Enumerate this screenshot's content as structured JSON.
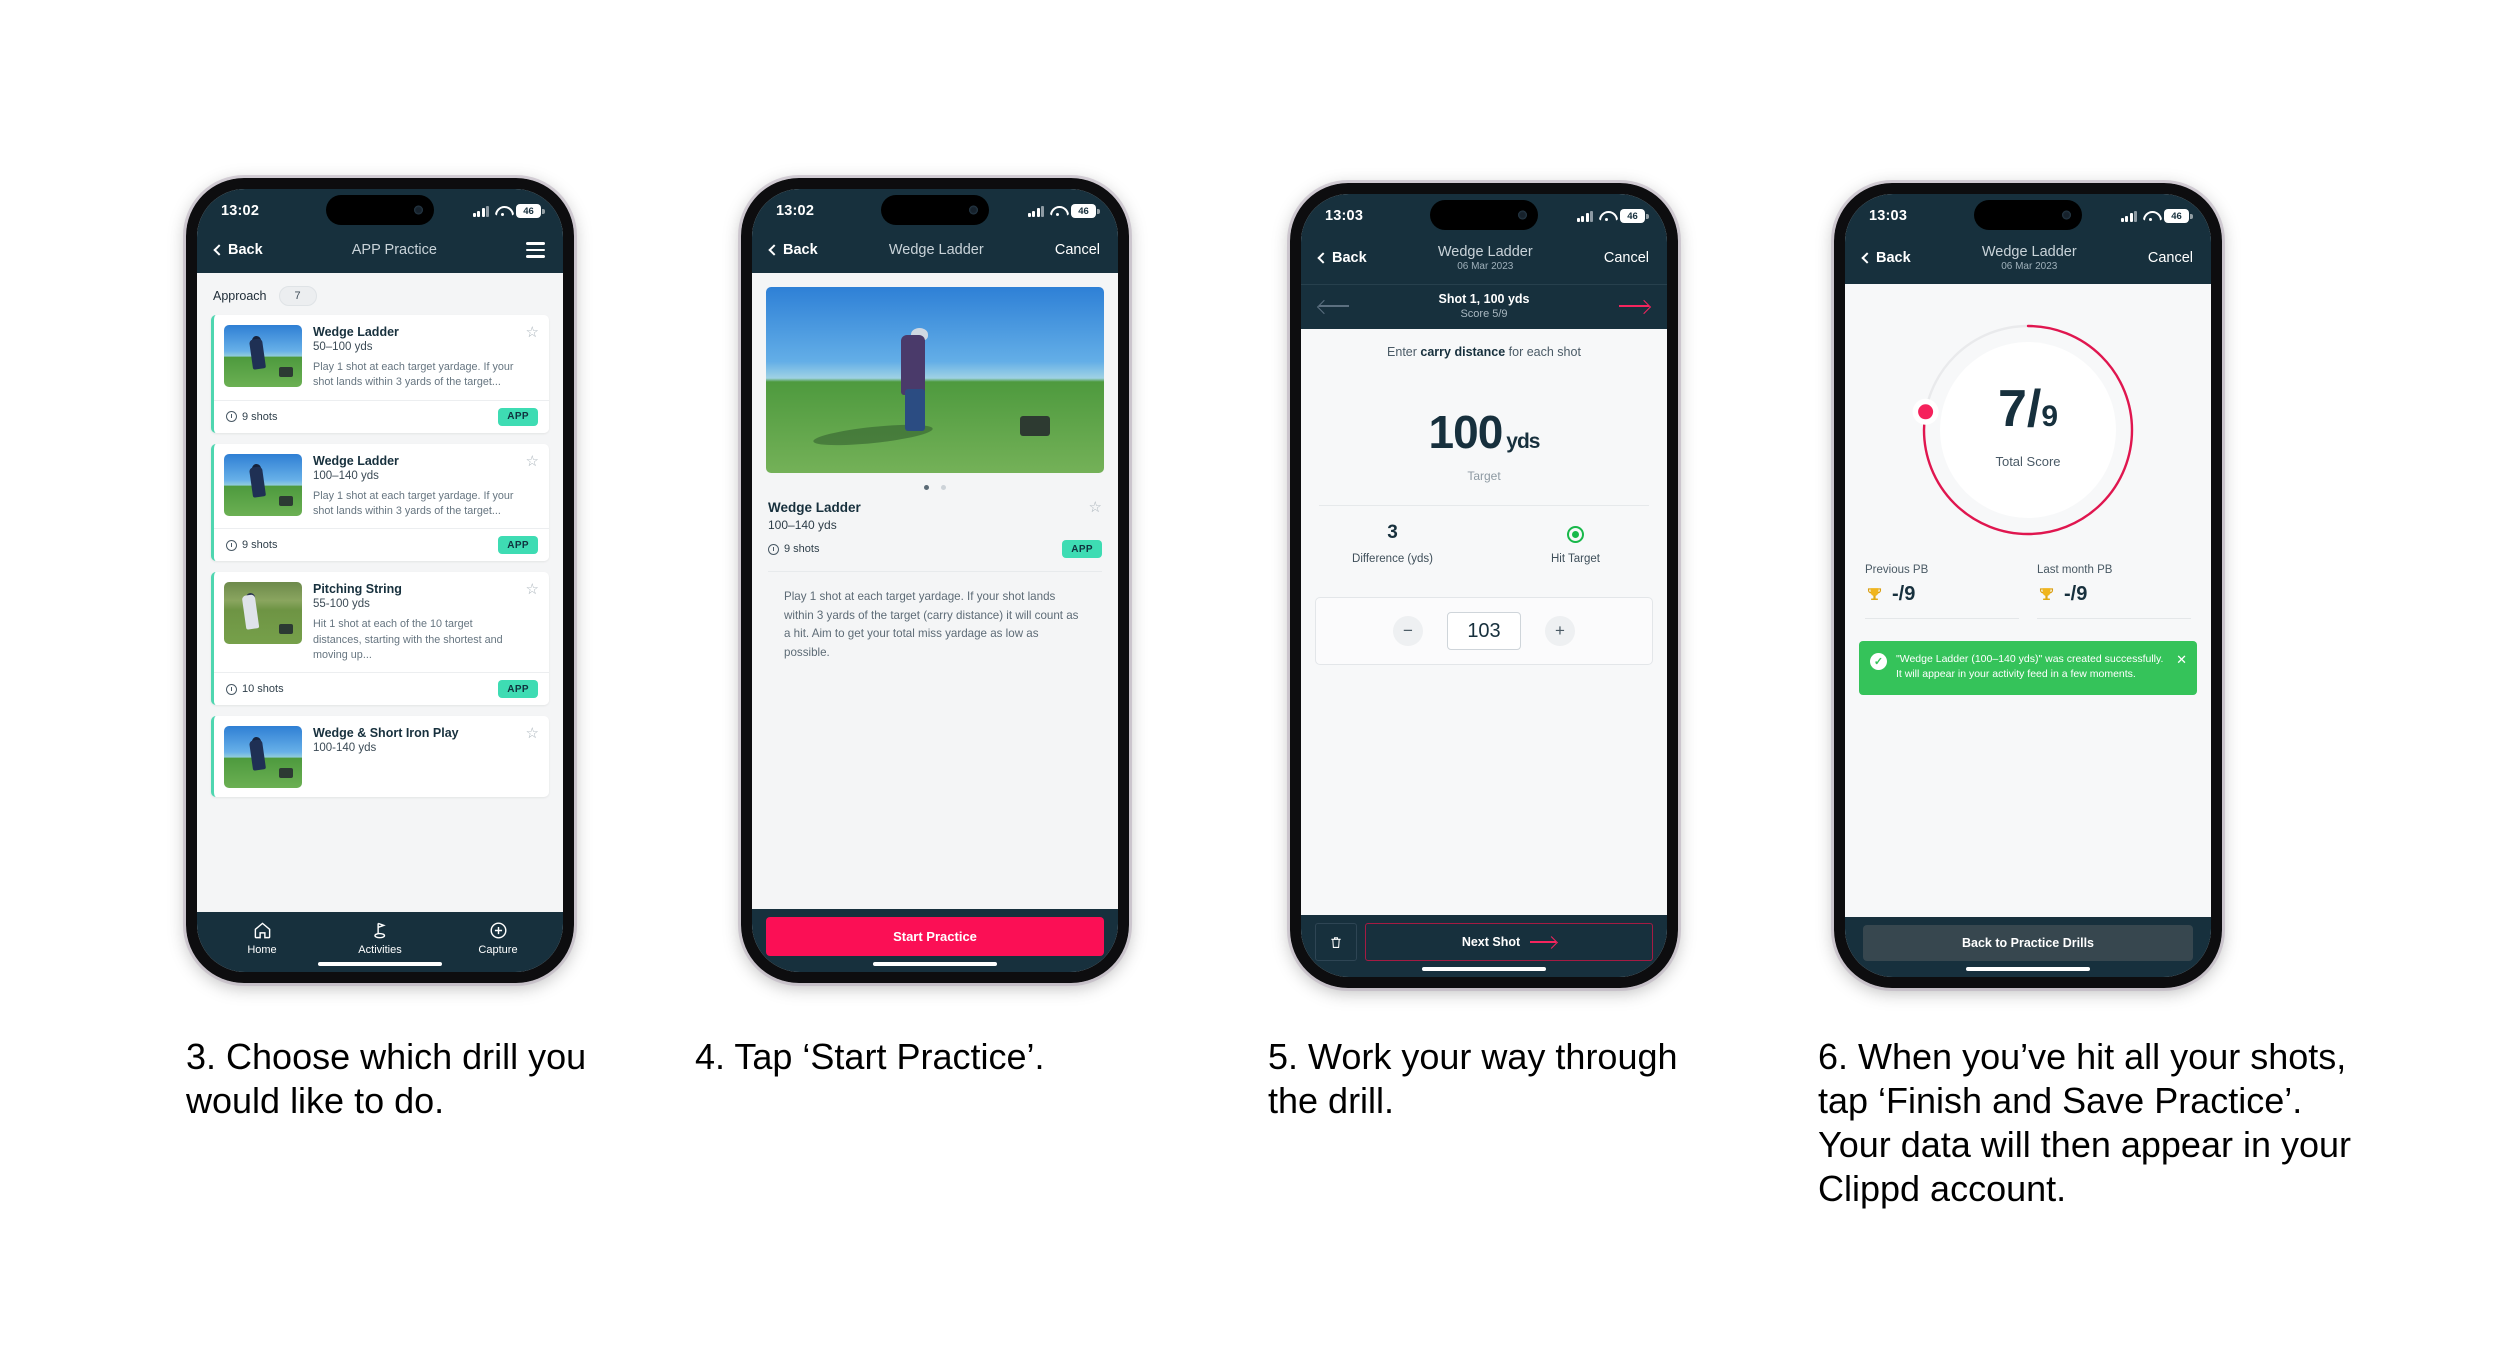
{
  "phone1": {
    "status": {
      "time": "13:02",
      "battery": "46",
      "signal_icon": "cellular-bars-icon",
      "wifi_icon": "wifi-icon"
    },
    "nav": {
      "back": "Back",
      "title": "APP Practice",
      "menu_icon": "hamburger-menu-icon"
    },
    "section": {
      "label": "Approach",
      "count": "7"
    },
    "drills": [
      {
        "name": "Wedge Ladder",
        "range": "50–100 yds",
        "desc": "Play 1 shot at each target yardage. If your shot lands within 3 yards of the target...",
        "shots": "9 shots",
        "badge": "APP"
      },
      {
        "name": "Wedge Ladder",
        "range": "100–140 yds",
        "desc": "Play 1 shot at each target yardage. If your shot lands within 3 yards of the target...",
        "shots": "9 shots",
        "badge": "APP"
      },
      {
        "name": "Pitching String",
        "range": "55-100 yds",
        "desc": "Hit 1 shot at each of the 10 target distances, starting with the shortest and moving up...",
        "shots": "10 shots",
        "badge": "APP"
      },
      {
        "name": "Wedge & Short Iron Play",
        "range": "100-140 yds",
        "desc": "",
        "shots": "",
        "badge": ""
      }
    ],
    "tabs": [
      {
        "label": "Home",
        "icon": "home-icon"
      },
      {
        "label": "Activities",
        "icon": "golf-flag-icon"
      },
      {
        "label": "Capture",
        "icon": "plus-circle-icon"
      }
    ]
  },
  "phone2": {
    "status": {
      "time": "13:02",
      "battery": "46"
    },
    "nav": {
      "back": "Back",
      "title": "Wedge Ladder",
      "cancel": "Cancel"
    },
    "detail": {
      "title": "Wedge Ladder",
      "range": "100–140 yds",
      "shots": "9 shots",
      "badge": "APP",
      "description": "Play 1 shot at each target yardage. If your shot lands within 3 yards of the target (carry distance) it will count as a hit. Aim to get your total miss yardage as low as possible."
    },
    "cta": "Start Practice"
  },
  "phone3": {
    "status": {
      "time": "13:03",
      "battery": "46"
    },
    "nav": {
      "back": "Back",
      "title": "Wedge Ladder",
      "subtitle": "06 Mar 2023",
      "cancel": "Cancel"
    },
    "subnav": {
      "shot": "Shot 1, 100 yds",
      "score": "Score 5/9",
      "prev_icon": "arrow-left-icon",
      "next_icon": "arrow-right-icon"
    },
    "prompt_pre": "Enter ",
    "prompt_bold": "carry distance",
    "prompt_post": " for each shot",
    "target": {
      "value": "100",
      "unit": "yds",
      "label": "Target"
    },
    "stats": [
      {
        "value": "3",
        "label": "Difference (yds)"
      },
      {
        "value": "",
        "label": "Hit Target",
        "icon": "target-hit-icon"
      }
    ],
    "stepper": {
      "minus": "−",
      "value": "103",
      "plus": "+"
    },
    "footer": {
      "delete_icon": "trash-icon",
      "next": "Next Shot"
    }
  },
  "phone4": {
    "status": {
      "time": "13:03",
      "battery": "46"
    },
    "nav": {
      "back": "Back",
      "title": "Wedge Ladder",
      "subtitle": "06 Mar 2023",
      "cancel": "Cancel"
    },
    "score": {
      "value": "7",
      "total": "9",
      "separator": "/",
      "label": "Total Score",
      "progress_pct": 77.8
    },
    "pbs": [
      {
        "label": "Previous PB",
        "value": "-/9",
        "icon": "trophy-icon"
      },
      {
        "label": "Last month PB",
        "value": "-/9",
        "icon": "trophy-icon"
      }
    ],
    "toast": {
      "text": "\"Wedge Ladder (100–140 yds)\" was created successfully. It will appear in your activity feed in a few moments.",
      "check_icon": "check-circle-icon",
      "close_icon": "close-icon"
    },
    "button": "Back to Practice Drills"
  },
  "captions": [
    "3. Choose which drill you would like to do.",
    "4. Tap ‘Start Practice’.",
    "5. Work your way through the drill.",
    "6. When you’ve hit all your shots, tap ‘Finish and Save Practice’. Your data will then appear in your Clippd account."
  ],
  "colors": {
    "dark_ui": "#17303d",
    "accent_pink": "#fb0f55",
    "badge_teal": "#3edcb3",
    "success_green": "#35c35a",
    "ring_pink": "#e0164f"
  }
}
